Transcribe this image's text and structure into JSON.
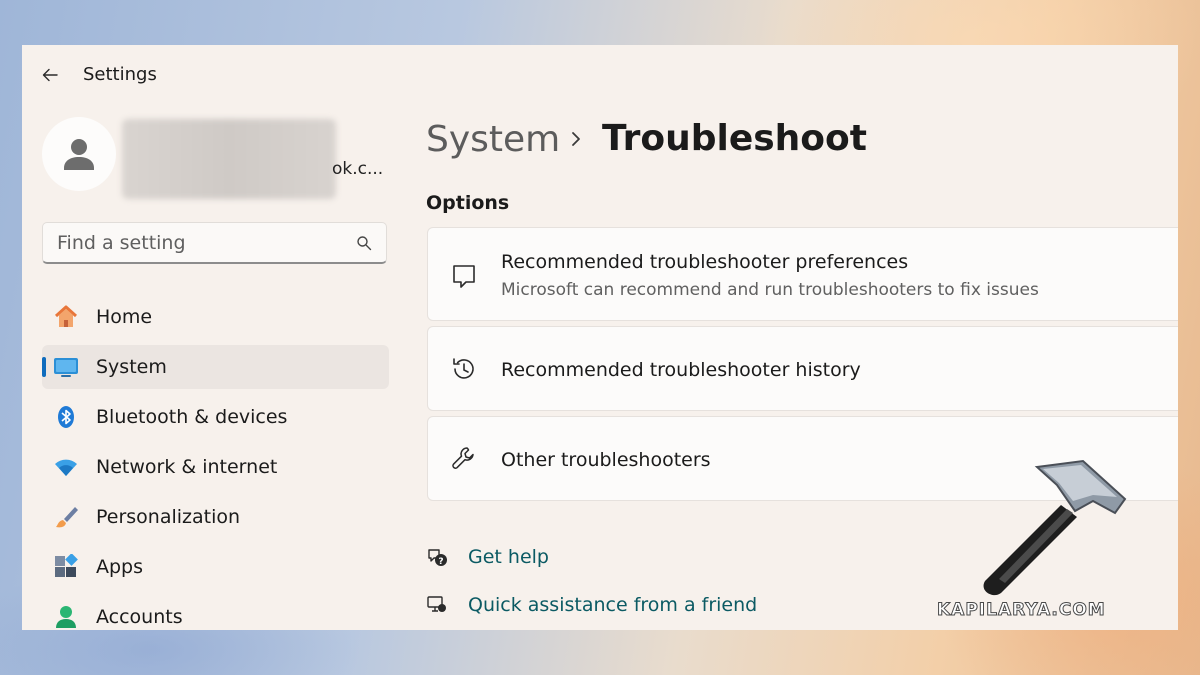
{
  "window": {
    "title": "Settings"
  },
  "profile": {
    "email_fragment": "ok.c..."
  },
  "search": {
    "placeholder": "Find a setting"
  },
  "sidebar": {
    "items": [
      {
        "label": "Home",
        "icon": "home-icon"
      },
      {
        "label": "System",
        "icon": "system-icon",
        "selected": true
      },
      {
        "label": "Bluetooth & devices",
        "icon": "bluetooth-icon"
      },
      {
        "label": "Network & internet",
        "icon": "wifi-icon"
      },
      {
        "label": "Personalization",
        "icon": "brush-icon"
      },
      {
        "label": "Apps",
        "icon": "apps-icon"
      },
      {
        "label": "Accounts",
        "icon": "account-icon"
      }
    ]
  },
  "breadcrumb": {
    "parent": "System",
    "current": "Troubleshoot"
  },
  "options": {
    "title": "Options",
    "cards": [
      {
        "title": "Recommended troubleshooter preferences",
        "description": "Microsoft can recommend and run troubleshooters to fix issues",
        "icon": "chat-bubble-icon"
      },
      {
        "title": "Recommended troubleshooter history",
        "icon": "history-icon"
      },
      {
        "title": "Other troubleshooters",
        "icon": "wrench-icon"
      }
    ]
  },
  "help_links": [
    {
      "label": "Get help",
      "icon": "help-icon"
    },
    {
      "label": "Quick assistance from a friend",
      "icon": "remote-assist-icon"
    }
  ],
  "watermark": {
    "text": "KAPILARYA.COM"
  },
  "colors": {
    "accent": "#0f6cbd",
    "link": "#0b5a63",
    "window_bg": "#f7f1ec"
  }
}
